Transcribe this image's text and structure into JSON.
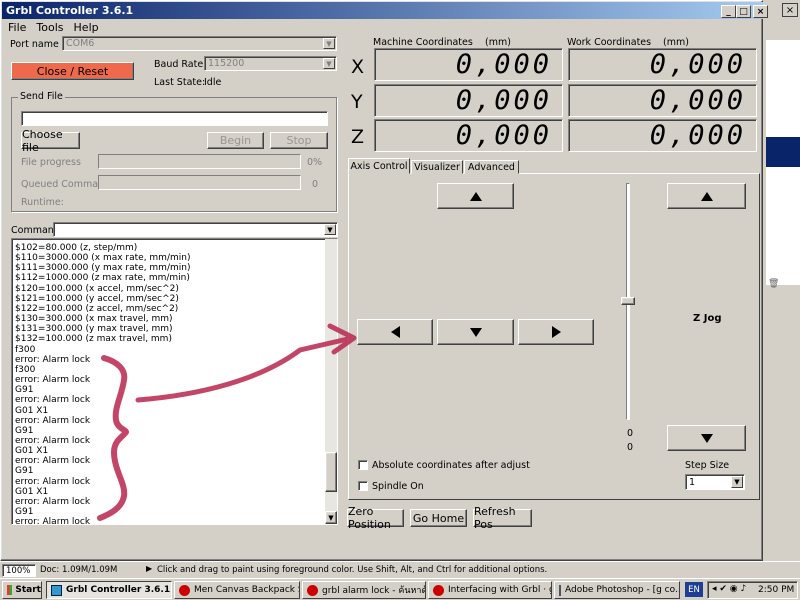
{
  "window": {
    "title": "Grbl Controller 3.6.1",
    "min_label": "_",
    "max_label": "□",
    "close_label": "×"
  },
  "menu": [
    "File",
    "Tools",
    "Help"
  ],
  "connection": {
    "port_label": "Port name",
    "port_value": "COM6",
    "open_close_label": "Close / Reset",
    "baud_label": "Baud Rate",
    "baud_value": "115200",
    "last_state_label": "Last State:",
    "last_state_value": "Idle"
  },
  "send_file": {
    "title": "Send File",
    "choose_label": "Choose file",
    "begin_label": "Begin",
    "stop_label": "Stop",
    "progress_label": "File progress",
    "progress_value": "0%",
    "progress_fraction": 0,
    "queued_label": "Queued Commands",
    "queued_value": "0",
    "runtime_label": "Runtime:"
  },
  "command": {
    "label": "Command",
    "value": ""
  },
  "console_lines": [
    "$102=80.000 (z, step/mm)",
    "$110=3000.000 (x max rate, mm/min)",
    "$111=3000.000 (y max rate, mm/min)",
    "$112=1000.000 (z max rate, mm/min)",
    "$120=100.000 (x accel, mm/sec^2)",
    "$121=100.000 (y accel, mm/sec^2)",
    "$122=100.000 (z accel, mm/sec^2)",
    "$130=300.000 (x max travel, mm)",
    "$131=300.000 (y max travel, mm)",
    "$132=100.000 (z max travel, mm)",
    "f300",
    "error: Alarm lock",
    "f300",
    "error: Alarm lock",
    "G91",
    "error: Alarm lock",
    "G01 X1",
    "error: Alarm lock",
    "G91",
    "error: Alarm lock",
    "G01 X1",
    "error: Alarm lock",
    "G91",
    "error: Alarm lock",
    "G01 X1",
    "error: Alarm lock",
    "G91",
    "error: Alarm lock"
  ],
  "coordinates": {
    "machine_label": "Machine Coordinates",
    "work_label": "Work Coordinates",
    "unit": "(mm)",
    "axes": [
      "X",
      "Y",
      "Z"
    ],
    "machine": [
      "0,000",
      "0,000",
      "0,000"
    ],
    "work": [
      "0,000",
      "0,000",
      "0,000"
    ]
  },
  "tabs": [
    "Axis Control",
    "Visualizer",
    "Advanced"
  ],
  "axis_control": {
    "z_jog_label": "Z Jog",
    "slider_value_a": "0",
    "slider_value_b": "0",
    "step_size_label": "Step Size",
    "step_size_value": "1",
    "abs_coords_label": "Absolute coordinates after adjust",
    "spindle_label": "Spindle On"
  },
  "bottom_buttons": {
    "zero": "Zero Position",
    "home": "Go Home",
    "refresh": "Refresh Pos"
  },
  "photoshop": {
    "zoom": "100%",
    "doc": "Doc: 1.09M/1.09M",
    "hint": "Click and drag to paint using foreground color.  Use Shift, Alt, and Ctrl for additional options."
  },
  "taskbar": {
    "start": "Start",
    "tasks": [
      "Grbl Controller 3.6.1",
      "Men Canvas Backpack S...",
      "grbl alarm lock - ค้นหาด้ว...",
      "Interfacing with Grbl · gr...",
      "Adobe Photoshop - [g co..."
    ],
    "lang": "EN",
    "time": "2:50 PM"
  },
  "annotation_color": "#b8264f"
}
